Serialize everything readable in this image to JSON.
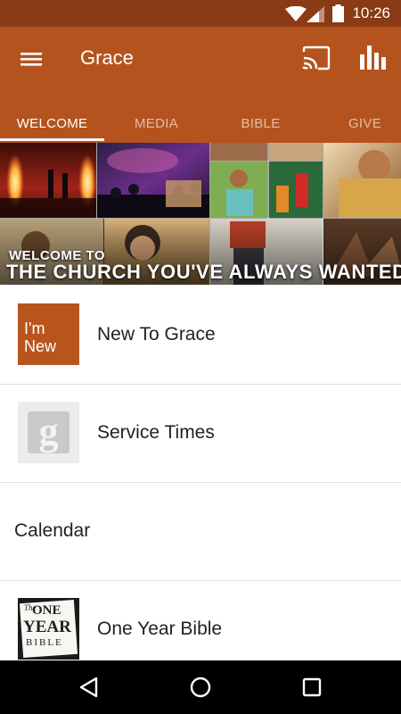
{
  "status_bar": {
    "time": "10:26"
  },
  "app_bar": {
    "title": "Grace"
  },
  "tabs": [
    {
      "label": "WELCOME",
      "active": true
    },
    {
      "label": "MEDIA",
      "active": false
    },
    {
      "label": "BIBLE",
      "active": false
    },
    {
      "label": "GIVE",
      "active": false
    }
  ],
  "banner": {
    "line1": "WELCOME TO",
    "line2": "THE CHURCH YOU'VE ALWAYS WANTED"
  },
  "list": [
    {
      "label": "New To Grace",
      "thumb_text": [
        "I'm",
        "New"
      ]
    },
    {
      "label": "Service Times",
      "thumb_text": "g"
    },
    {
      "label": "Calendar"
    },
    {
      "label": "One Year Bible",
      "thumb_text": [
        "The",
        "ONE",
        "YEAR",
        "BIBLE"
      ]
    }
  ],
  "colors": {
    "primary": "#b4531e",
    "status_bar": "#8a3a14",
    "thumb_orange": "#b8551c"
  },
  "icons": [
    "wifi-icon",
    "signal-icon",
    "battery-icon",
    "menu-icon",
    "cast-icon",
    "stats-icon",
    "back-icon",
    "home-icon",
    "recents-icon"
  ]
}
